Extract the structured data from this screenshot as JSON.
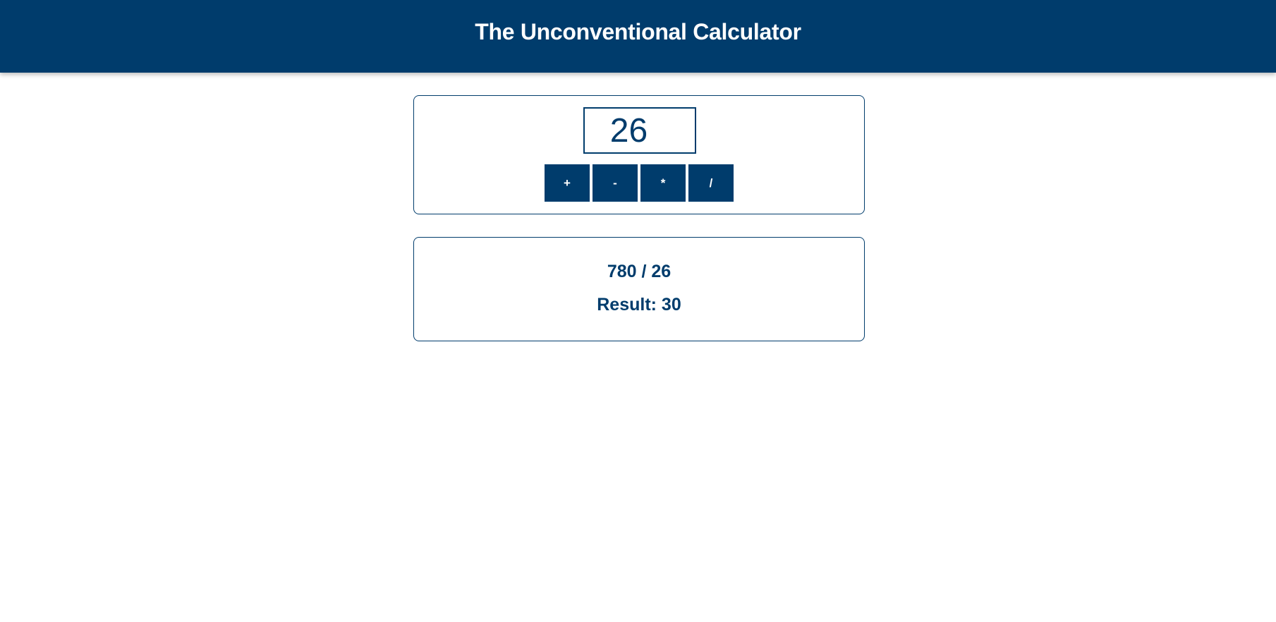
{
  "app": {
    "title": "The Unconventional Calculator"
  },
  "input": {
    "value": "26"
  },
  "operations": [
    {
      "label": "+"
    },
    {
      "label": "-"
    },
    {
      "label": "*"
    },
    {
      "label": "/"
    }
  ],
  "output": {
    "expression": "780 / 26",
    "result": "Result: 30"
  },
  "colors": {
    "primary": "#003c6c",
    "background": "#ffffff",
    "text_on_primary": "#ffffff"
  }
}
